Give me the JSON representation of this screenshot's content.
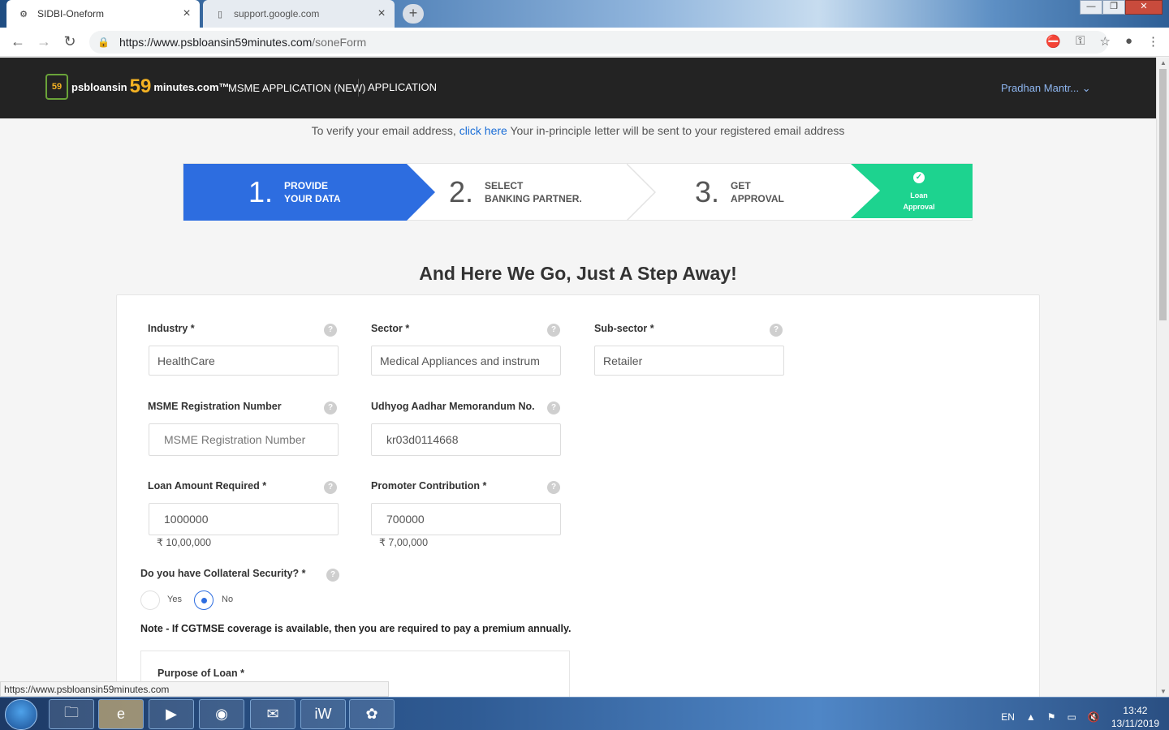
{
  "browser": {
    "tabs": [
      {
        "title": "SIDBI-Oneform",
        "active": true
      },
      {
        "title": "support.google.com",
        "active": false
      }
    ],
    "url_host": "https://www.psbloansin59minutes.com",
    "url_path": "/soneForm",
    "status_url": "https://www.psbloansin59minutes.com"
  },
  "header": {
    "logo_prefix": "psbloansin",
    "logo_num": "59",
    "logo_suffix": "minutes.com™",
    "logo_badge": "59",
    "menu_msme": "MSME APPLICATION (NEW)",
    "menu_application": "APPLICATION",
    "user_name": "Pradhan Mantr...  ⌄"
  },
  "verify": {
    "text_before": "To verify your email address, ",
    "link": "click here",
    "text_after": " Your in-principle letter will be sent to your registered email address"
  },
  "steps": [
    {
      "num": "1.",
      "line1": "PROVIDE",
      "line2": "YOUR DATA"
    },
    {
      "num": "2.",
      "line1": "SELECT",
      "line2": "BANKING PARTNER."
    },
    {
      "num": "3.",
      "line1": "GET",
      "line2": "APPROVAL"
    },
    {
      "line1": "Loan",
      "line2": "Approval"
    }
  ],
  "heading": "And Here We Go, Just A Step Away!",
  "form": {
    "industry": {
      "label": "Industry *",
      "value": "HealthCare"
    },
    "sector": {
      "label": "Sector *",
      "value": "Medical Appliances and instrum"
    },
    "subsector": {
      "label": "Sub-sector *",
      "value": "Retailer"
    },
    "msme_reg": {
      "label": "MSME Registration Number",
      "placeholder": "MSME Registration Number"
    },
    "udhyog": {
      "label": "Udhyog Aadhar Memorandum No.",
      "value": "kr03d0114668"
    },
    "loan": {
      "label": "Loan Amount Required *",
      "value": "1000000",
      "formatted": "₹ 10,00,000"
    },
    "promoter": {
      "label": "Promoter Contribution *",
      "value": "700000",
      "formatted": "₹ 7,00,000"
    },
    "collateral": {
      "label": "Do you have Collateral Security? *",
      "yes": "Yes",
      "no": "No",
      "selected": "No"
    },
    "note": "Note - If CGTMSE coverage is available, then you are required to pay a premium annually.",
    "purpose": {
      "label": "Purpose of Loan *"
    },
    "help": "?"
  },
  "taskbar": {
    "lang": "EN",
    "time": "13:42",
    "date": "13/11/2019"
  }
}
